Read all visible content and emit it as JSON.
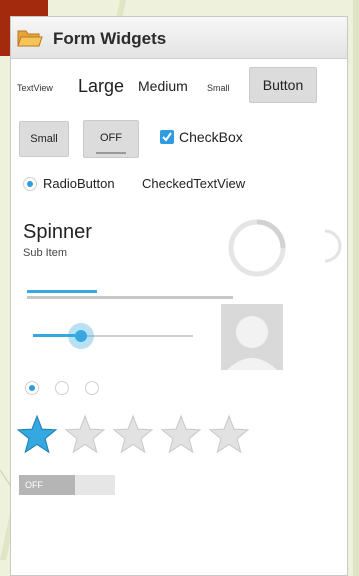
{
  "window": {
    "title": "Form Widgets",
    "title_icon": "folder-open-icon"
  },
  "row1": {
    "textview_small": "TextView",
    "large": "Large",
    "medium": "Medium",
    "small": "Small",
    "button_label": "Button"
  },
  "row2": {
    "small_button_label": "Small",
    "toggle_label": "OFF",
    "checkbox_label": "CheckBox",
    "checkbox_checked": true
  },
  "row3": {
    "radio_label": "RadioButton",
    "radio_checked": true,
    "checked_textview": "CheckedTextView"
  },
  "spinner": {
    "title": "Spinner",
    "subtitle": "Sub Item"
  },
  "seekbar": {
    "value_fraction": 0.3
  },
  "radio_group": {
    "selected_index": 0,
    "count": 3
  },
  "rating": {
    "stars": 5,
    "rating": 1
  },
  "switch": {
    "label": "OFF"
  },
  "colors": {
    "accent": "#35a8e0",
    "title_bar": "#e9e9e9",
    "slide_corner": "#a32a0c",
    "slide_bg": "#eef2dc"
  }
}
